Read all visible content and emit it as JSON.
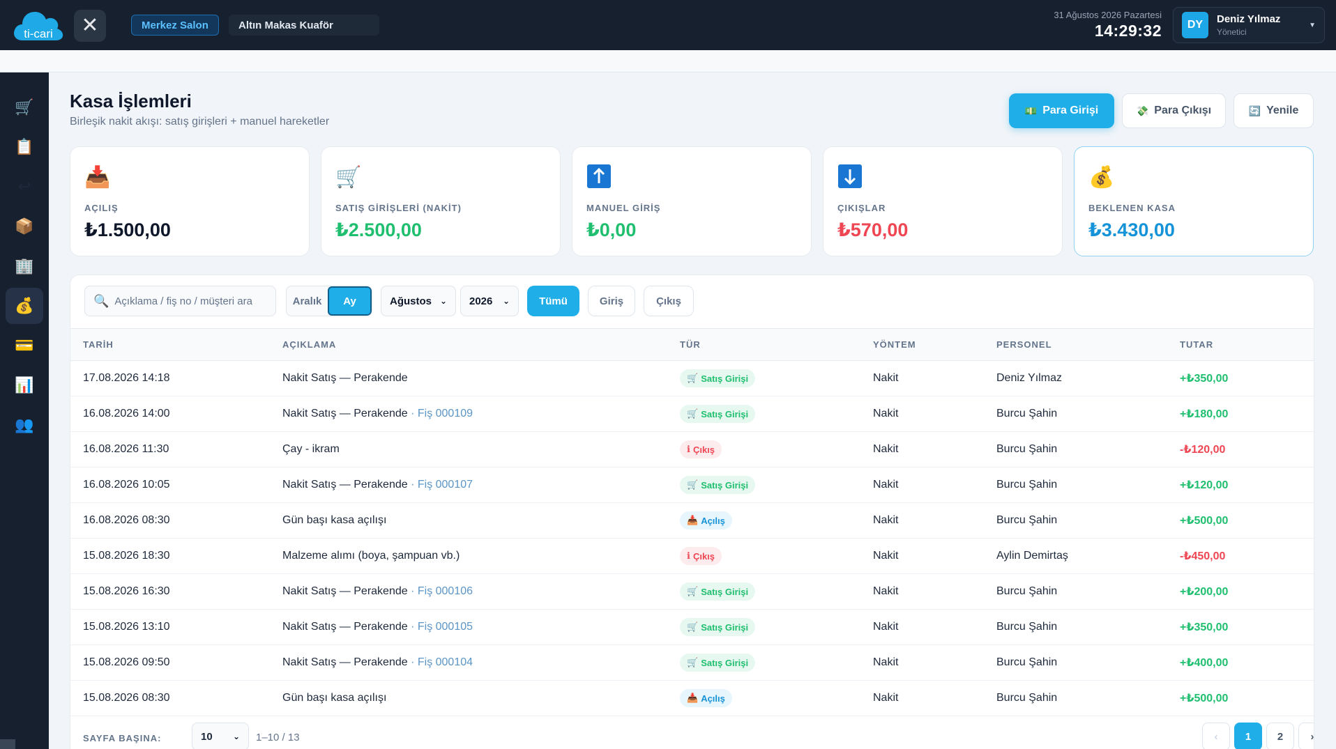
{
  "header": {
    "logo_text": "ti-cari",
    "close_symbol": "✕",
    "branch": "Merkez Salon",
    "salon": "Altın Makas Kuaför",
    "date": "31 Ağustos 2026 Pazartesi",
    "time": "14:29:32",
    "user": {
      "initials": "DY",
      "name": "Deniz Yılmaz",
      "role": "Yönetici"
    }
  },
  "sidebar": {
    "items": [
      {
        "icon": "cart-icon",
        "glyph": "🛒"
      },
      {
        "icon": "clipboard-icon",
        "glyph": "📋"
      },
      {
        "icon": "return-icon",
        "glyph": "↩"
      },
      {
        "icon": "box-icon",
        "glyph": "📦"
      },
      {
        "icon": "building-icon",
        "glyph": "🏢"
      },
      {
        "icon": "money-bag-icon",
        "glyph": "💰"
      },
      {
        "icon": "credit-card-icon",
        "glyph": "💳"
      },
      {
        "icon": "bar-chart-icon",
        "glyph": "📊"
      },
      {
        "icon": "users-icon",
        "glyph": "👥"
      }
    ],
    "active_index": 5
  },
  "page": {
    "title": "Kasa İşlemleri",
    "subtitle": "Birleşik nakit akışı: satış girişleri + manuel hareketler"
  },
  "actions": {
    "cash_in": {
      "label": "Para Girişi",
      "glyph": "💵"
    },
    "cash_out": {
      "label": "Para Çıkışı",
      "glyph": "💸"
    },
    "refresh": {
      "label": "Yenile",
      "glyph": "🔄"
    }
  },
  "stats": [
    {
      "label": "AÇILIŞ",
      "value": "₺1.500,00",
      "glyph": "📥",
      "icon": "inbox-icon",
      "color": "dark"
    },
    {
      "label": "SATIŞ GİRİŞLERİ (NAKİT)",
      "value": "₺2.500,00",
      "glyph": "🛒",
      "icon": "cart-icon",
      "color": "green"
    },
    {
      "label": "MANUEL GİRİŞ",
      "value": "₺0,00",
      "glyph": "⬆",
      "icon": "arrow-up-icon",
      "color": "green"
    },
    {
      "label": "ÇIKIŞLAR",
      "value": "₺570,00",
      "glyph": "⬇",
      "icon": "arrow-down-icon",
      "color": "red"
    },
    {
      "label": "BEKLENEN KASA",
      "value": "₺3.430,00",
      "glyph": "💰",
      "icon": "money-bag-icon",
      "color": "blue"
    }
  ],
  "filters": {
    "search_placeholder": "Açıklama / fiş no / müşteri ara",
    "range_label": "Aralık",
    "month_label": "Ay",
    "month_value": "Ağustos",
    "year_value": "2026",
    "type_all": "Tümü",
    "type_in": "Giriş",
    "type_out": "Çıkış"
  },
  "table": {
    "headers": [
      "TARİH",
      "AÇIKLAMA",
      "TÜR",
      "YÖNTEM",
      "PERSONEL",
      "TUTAR"
    ],
    "rows": [
      {
        "date": "17.08.2026 14:18",
        "desc": "Nakit Satış — Perakende",
        "receipt": "",
        "type": "Satış Girişi",
        "kind": "sale",
        "method": "Nakit",
        "staff": "Deniz Yılmaz",
        "amount": "+₺350,00",
        "sign": "pos"
      },
      {
        "date": "16.08.2026 14:00",
        "desc": "Nakit Satış — Perakende",
        "receipt": "Fiş 000109",
        "type": "Satış Girişi",
        "kind": "sale",
        "method": "Nakit",
        "staff": "Burcu Şahin",
        "amount": "+₺180,00",
        "sign": "pos"
      },
      {
        "date": "16.08.2026 11:30",
        "desc": "Çay - ikram",
        "receipt": "",
        "type": "Çıkış",
        "kind": "out",
        "method": "Nakit",
        "staff": "Burcu Şahin",
        "amount": "-₺120,00",
        "sign": "neg"
      },
      {
        "date": "16.08.2026 10:05",
        "desc": "Nakit Satış — Perakende",
        "receipt": "Fiş 000107",
        "type": "Satış Girişi",
        "kind": "sale",
        "method": "Nakit",
        "staff": "Burcu Şahin",
        "amount": "+₺120,00",
        "sign": "pos"
      },
      {
        "date": "16.08.2026 08:30",
        "desc": "Gün başı kasa açılışı",
        "receipt": "",
        "type": "Açılış",
        "kind": "open",
        "method": "Nakit",
        "staff": "Burcu Şahin",
        "amount": "+₺500,00",
        "sign": "pos"
      },
      {
        "date": "15.08.2026 18:30",
        "desc": "Malzeme alımı (boya, şampuan vb.)",
        "receipt": "",
        "type": "Çıkış",
        "kind": "out",
        "method": "Nakit",
        "staff": "Aylin Demirtaş",
        "amount": "-₺450,00",
        "sign": "neg"
      },
      {
        "date": "15.08.2026 16:30",
        "desc": "Nakit Satış — Perakende",
        "receipt": "Fiş 000106",
        "type": "Satış Girişi",
        "kind": "sale",
        "method": "Nakit",
        "staff": "Burcu Şahin",
        "amount": "+₺200,00",
        "sign": "pos"
      },
      {
        "date": "15.08.2026 13:10",
        "desc": "Nakit Satış — Perakende",
        "receipt": "Fiş 000105",
        "type": "Satış Girişi",
        "kind": "sale",
        "method": "Nakit",
        "staff": "Burcu Şahin",
        "amount": "+₺350,00",
        "sign": "pos"
      },
      {
        "date": "15.08.2026 09:50",
        "desc": "Nakit Satış — Perakende",
        "receipt": "Fiş 000104",
        "type": "Satış Girişi",
        "kind": "sale",
        "method": "Nakit",
        "staff": "Burcu Şahin",
        "amount": "+₺400,00",
        "sign": "pos"
      },
      {
        "date": "15.08.2026 08:30",
        "desc": "Gün başı kasa açılışı",
        "receipt": "",
        "type": "Açılış",
        "kind": "open",
        "method": "Nakit",
        "staff": "Burcu Şahin",
        "amount": "+₺500,00",
        "sign": "pos"
      }
    ]
  },
  "badge_glyphs": {
    "sale": "🛒",
    "out": "ℹ",
    "open": "📥"
  },
  "pagination": {
    "per_page_label": "SAYFA BAŞINA:",
    "per_page_value": "10",
    "range": "1–10 / 13",
    "prev": "‹",
    "next": "›",
    "pages": [
      "1",
      "2"
    ],
    "current": "1"
  },
  "colors": {
    "accent": "#20aee8",
    "topbar": "#16202f",
    "green": "#1fbf6f",
    "red": "#ef4653"
  }
}
